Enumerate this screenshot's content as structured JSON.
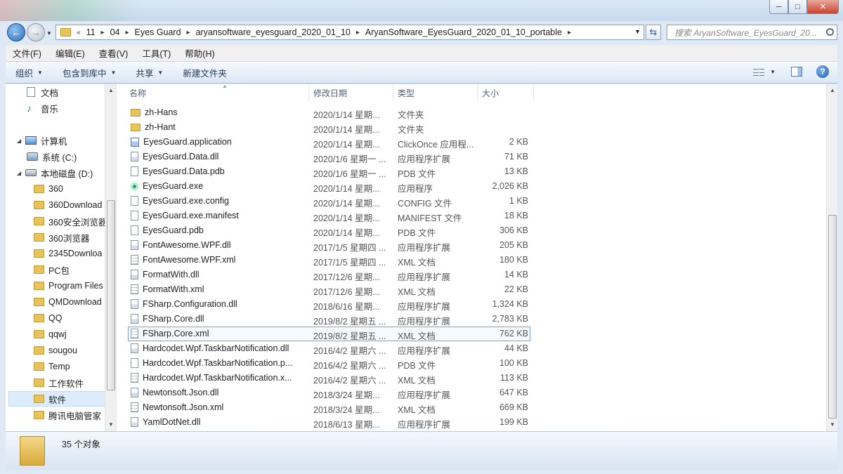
{
  "window": {
    "minimize": "─",
    "maximize": "□",
    "close": "✕"
  },
  "address": {
    "chevron": "«",
    "crumbs": [
      "11",
      "04",
      "Eyes Guard",
      "aryansoftware_eyesguard_2020_01_10",
      "AryanSoftware_EyesGuard_2020_01_10_portable"
    ],
    "search_placeholder": "搜索 AryanSoftware_EyesGuard_20..."
  },
  "menu": [
    "文件(F)",
    "编辑(E)",
    "查看(V)",
    "工具(T)",
    "帮助(H)"
  ],
  "commands": {
    "organize": "组织",
    "include_library": "包含到库中",
    "share": "共享",
    "new_folder": "新建文件夹"
  },
  "nav": {
    "documents": "文档",
    "music": "音乐",
    "computer": "计算机",
    "system_drive": "系统 (C:)",
    "local_disk": "本地磁盘 (D:)",
    "folders": [
      "360",
      "360Download",
      "360安全浏览器",
      "360浏览器",
      "2345Downloa",
      "PC包",
      "Program Files",
      "QMDownload",
      "QQ",
      "qqwj",
      "sougou",
      "Temp",
      "工作软件",
      "软件",
      "腾讯电脑管家"
    ],
    "selected_folder": "软件"
  },
  "columns": {
    "name": "名称",
    "date": "修改日期",
    "type": "类型",
    "size": "大小"
  },
  "files": [
    {
      "name": "zh-Hans",
      "date": "2020/1/14 星期...",
      "type": "文件夹",
      "size": "",
      "icon": "folder-icon"
    },
    {
      "name": "zh-Hant",
      "date": "2020/1/14 星期...",
      "type": "文件夹",
      "size": "",
      "icon": "folder-icon"
    },
    {
      "name": "EyesGuard.application",
      "date": "2020/1/14 星期...",
      "type": "ClickOnce 应用程...",
      "size": "2 KB",
      "icon": "application-icon"
    },
    {
      "name": "EyesGuard.Data.dll",
      "date": "2020/1/6 星期一 ...",
      "type": "应用程序扩展",
      "size": "71 KB",
      "icon": "dll-icon"
    },
    {
      "name": "EyesGuard.Data.pdb",
      "date": "2020/1/6 星期一 ...",
      "type": "PDB 文件",
      "size": "13 KB",
      "icon": "file-icon"
    },
    {
      "name": "EyesGuard.exe",
      "date": "2020/1/14 星期...",
      "type": "应用程序",
      "size": "2,026 KB",
      "icon": "exe-icon"
    },
    {
      "name": "EyesGuard.exe.config",
      "date": "2020/1/14 星期...",
      "type": "CONFIG 文件",
      "size": "1 KB",
      "icon": "file-icon"
    },
    {
      "name": "EyesGuard.exe.manifest",
      "date": "2020/1/14 星期...",
      "type": "MANIFEST 文件",
      "size": "18 KB",
      "icon": "file-icon"
    },
    {
      "name": "EyesGuard.pdb",
      "date": "2020/1/14 星期...",
      "type": "PDB 文件",
      "size": "306 KB",
      "icon": "file-icon"
    },
    {
      "name": "FontAwesome.WPF.dll",
      "date": "2017/1/5 星期四 ...",
      "type": "应用程序扩展",
      "size": "205 KB",
      "icon": "dll-icon"
    },
    {
      "name": "FontAwesome.WPF.xml",
      "date": "2017/1/5 星期四 ...",
      "type": "XML 文档",
      "size": "180 KB",
      "icon": "xml-icon"
    },
    {
      "name": "FormatWith.dll",
      "date": "2017/12/6 星期...",
      "type": "应用程序扩展",
      "size": "14 KB",
      "icon": "dll-icon"
    },
    {
      "name": "FormatWith.xml",
      "date": "2017/12/6 星期...",
      "type": "XML 文档",
      "size": "22 KB",
      "icon": "xml-icon"
    },
    {
      "name": "FSharp.Configuration.dll",
      "date": "2018/6/16 星期...",
      "type": "应用程序扩展",
      "size": "1,324 KB",
      "icon": "dll-icon"
    },
    {
      "name": "FSharp.Core.dll",
      "date": "2019/8/2 星期五 ...",
      "type": "应用程序扩展",
      "size": "2,783 KB",
      "icon": "dll-icon"
    },
    {
      "name": "FSharp.Core.xml",
      "date": "2019/8/2 星期五 ...",
      "type": "XML 文档",
      "size": "762 KB",
      "icon": "xml-icon"
    },
    {
      "name": "Hardcodet.Wpf.TaskbarNotification.dll",
      "date": "2016/4/2 星期六 ...",
      "type": "应用程序扩展",
      "size": "44 KB",
      "icon": "dll-icon"
    },
    {
      "name": "Hardcodet.Wpf.TaskbarNotification.p...",
      "date": "2016/4/2 星期六 ...",
      "type": "PDB 文件",
      "size": "100 KB",
      "icon": "file-icon"
    },
    {
      "name": "Hardcodet.Wpf.TaskbarNotification.x...",
      "date": "2016/4/2 星期六 ...",
      "type": "XML 文档",
      "size": "113 KB",
      "icon": "xml-icon"
    },
    {
      "name": "Newtonsoft.Json.dll",
      "date": "2018/3/24 星期...",
      "type": "应用程序扩展",
      "size": "647 KB",
      "icon": "dll-icon"
    },
    {
      "name": "Newtonsoft.Json.xml",
      "date": "2018/3/24 星期...",
      "type": "XML 文档",
      "size": "669 KB",
      "icon": "xml-icon"
    },
    {
      "name": "YamlDotNet.dll",
      "date": "2018/6/13 星期...",
      "type": "应用程序扩展",
      "size": "199 KB",
      "icon": "dll-icon"
    }
  ],
  "selected_file": "FSharp.Core.xml",
  "status": {
    "count": "35 个对象"
  }
}
